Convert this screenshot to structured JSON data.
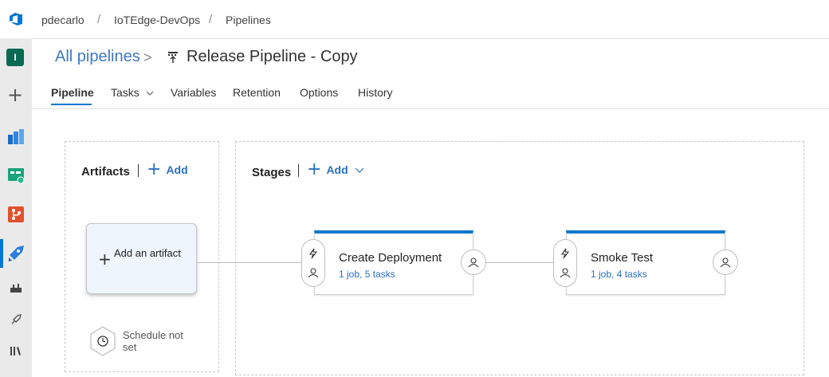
{
  "breadcrumb": {
    "org": "pdecarlo",
    "project": "IoTEdge-DevOps",
    "section": "Pipelines"
  },
  "sidebar": {
    "project_initial": "I"
  },
  "title": {
    "all_pipelines": "All pipelines",
    "pipeline_name": "Release Pipeline - Copy"
  },
  "tabs": [
    {
      "label": "Pipeline",
      "active": true
    },
    {
      "label": "Tasks"
    },
    {
      "label": "Variables"
    },
    {
      "label": "Retention"
    },
    {
      "label": "Options"
    },
    {
      "label": "History"
    }
  ],
  "artifacts": {
    "heading": "Artifacts",
    "add_label": "Add",
    "card_label": "Add an artifact",
    "schedule_label": "Schedule not set"
  },
  "stages": {
    "heading": "Stages",
    "add_label": "Add",
    "items": [
      {
        "name": "Create Deployment",
        "summary": "1 job, 5 tasks"
      },
      {
        "name": "Smoke Test",
        "summary": "1 job, 4 tasks"
      }
    ]
  },
  "colors": {
    "accent": "#0078d4",
    "link": "#2b70c2",
    "project_badge": "#0b6a53"
  }
}
